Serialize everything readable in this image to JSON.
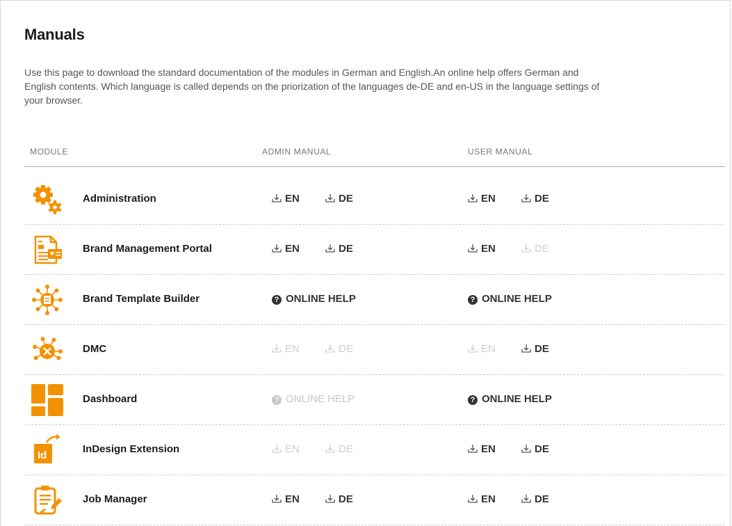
{
  "page": {
    "title": "Manuals",
    "intro": "Use this page to download the standard documentation of the modules in German and English.An online help offers German and English contents. Which language is called depends on the priorization of the languages de-DE and en-US in the language settings of your browser."
  },
  "table": {
    "headers": {
      "module": "MODULE",
      "admin": "ADMIN MANUAL",
      "user": "USER MANUAL"
    },
    "rows": [
      {
        "name": "Administration",
        "icon": "gears-icon",
        "admin": {
          "type": "dl",
          "en": "EN",
          "de": "DE",
          "en_enabled": true,
          "de_enabled": true
        },
        "user": {
          "type": "dl",
          "en": "EN",
          "de": "DE",
          "en_enabled": true,
          "de_enabled": true
        }
      },
      {
        "name": "Brand Management Portal",
        "icon": "portal-document-icon",
        "admin": {
          "type": "dl",
          "en": "EN",
          "de": "DE",
          "en_enabled": true,
          "de_enabled": true
        },
        "user": {
          "type": "dl",
          "en": "EN",
          "de": "DE",
          "en_enabled": true,
          "de_enabled": false
        }
      },
      {
        "name": "Brand Template Builder",
        "icon": "template-network-icon",
        "admin": {
          "type": "help",
          "label": "ONLINE HELP",
          "enabled": true
        },
        "user": {
          "type": "help",
          "label": "ONLINE HELP",
          "enabled": true
        }
      },
      {
        "name": "DMC",
        "icon": "dmc-network-icon",
        "admin": {
          "type": "dl",
          "en": "EN",
          "de": "DE",
          "en_enabled": false,
          "de_enabled": false
        },
        "user": {
          "type": "dl",
          "en": "EN",
          "de": "DE",
          "en_enabled": false,
          "de_enabled": true
        }
      },
      {
        "name": "Dashboard",
        "icon": "dashboard-tiles-icon",
        "admin": {
          "type": "help",
          "label": "ONLINE HELP",
          "enabled": false
        },
        "user": {
          "type": "help",
          "label": "ONLINE HELP",
          "enabled": true
        }
      },
      {
        "name": "InDesign Extension",
        "icon": "indesign-icon",
        "admin": {
          "type": "dl",
          "en": "EN",
          "de": "DE",
          "en_enabled": false,
          "de_enabled": false
        },
        "user": {
          "type": "dl",
          "en": "EN",
          "de": "DE",
          "en_enabled": true,
          "de_enabled": true
        }
      },
      {
        "name": "Job Manager",
        "icon": "clipboard-icon",
        "admin": {
          "type": "dl",
          "en": "EN",
          "de": "DE",
          "en_enabled": true,
          "de_enabled": true
        },
        "user": {
          "type": "dl",
          "en": "EN",
          "de": "DE",
          "en_enabled": true,
          "de_enabled": true
        }
      }
    ]
  },
  "colors": {
    "accent": "#f39200",
    "text": "#333333",
    "disabled": "#cfcfcf"
  }
}
